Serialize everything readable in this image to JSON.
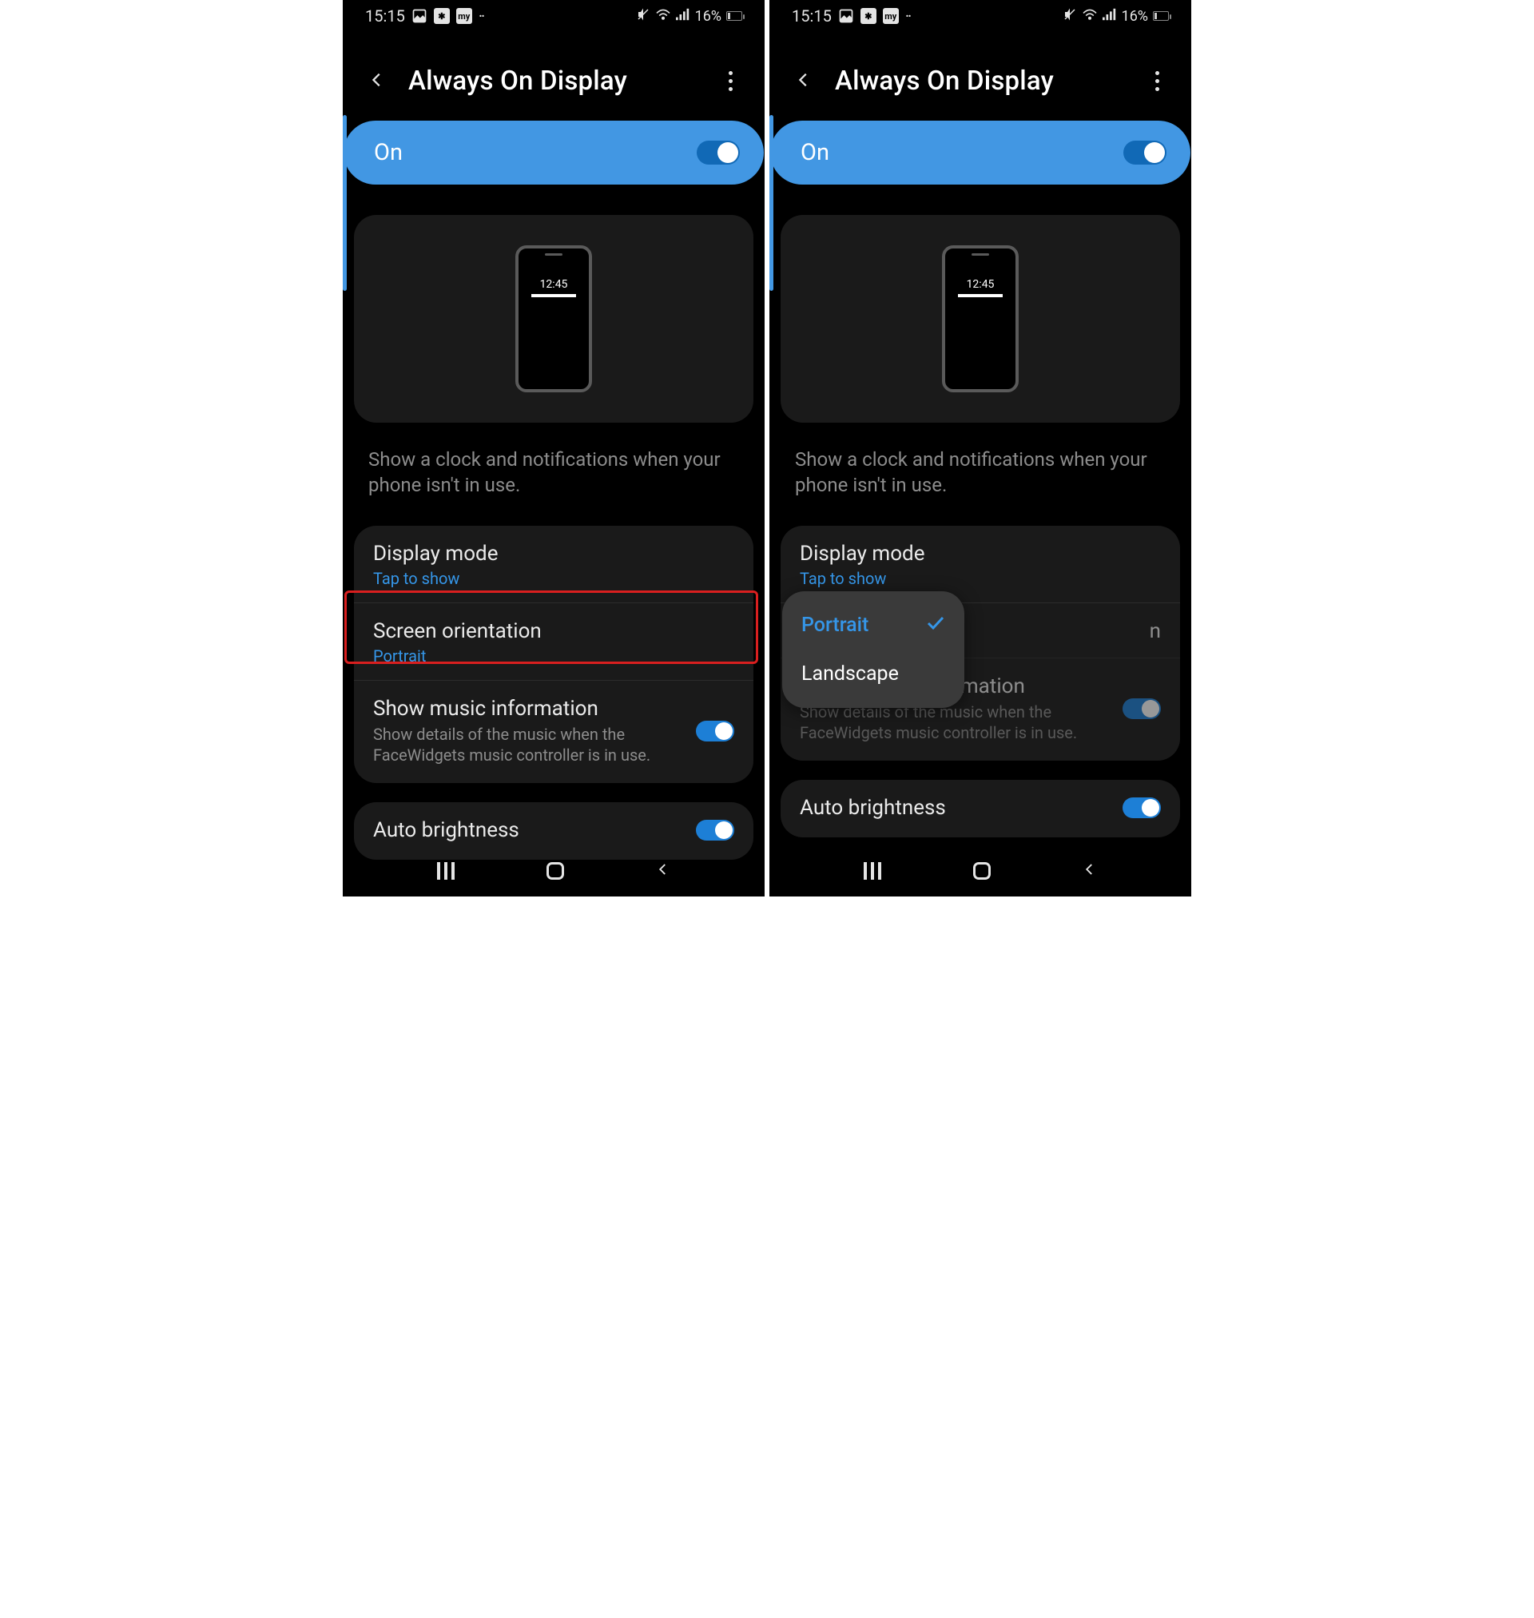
{
  "statusbar": {
    "time": "15:15",
    "battery_pct": "16%",
    "icons_left": [
      "image-icon",
      "slack-icon",
      "my-icon"
    ],
    "icons_right": [
      "mute-icon",
      "wifi-icon",
      "signal-icon"
    ]
  },
  "header": {
    "title": "Always On Display"
  },
  "on_toggle": {
    "label": "On",
    "state": true
  },
  "preview": {
    "clock": "12:45"
  },
  "description": "Show a clock and notifications when your phone isn't in use.",
  "rows": {
    "display_mode": {
      "title": "Display mode",
      "sub": "Tap to show"
    },
    "orientation": {
      "title": "Screen orientation",
      "sub": "Portrait"
    },
    "music": {
      "title": "Show music information",
      "sub": "Show details of the music when the FaceWidgets music controller is in use.",
      "toggle": true
    },
    "brightness": {
      "title": "Auto brightness",
      "toggle": true
    }
  },
  "right_panel": {
    "orientation_truncated_suffix": "n",
    "popup": {
      "portrait": "Portrait",
      "landscape": "Landscape",
      "selected": "Portrait"
    }
  }
}
